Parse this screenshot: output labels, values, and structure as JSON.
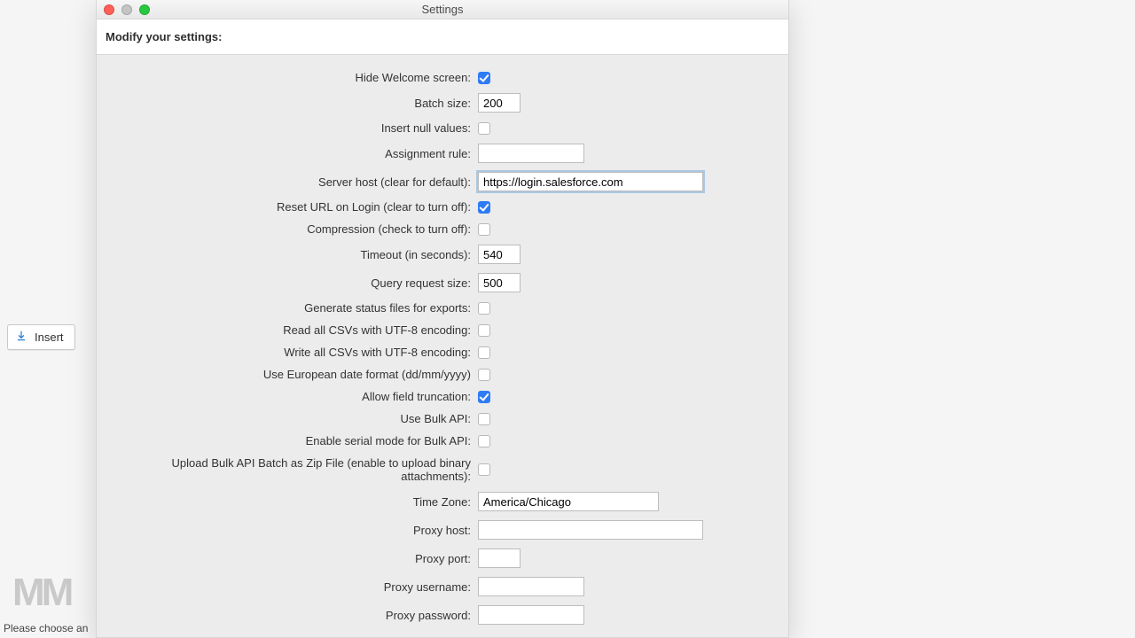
{
  "background": {
    "insert_button_label": "Insert",
    "status_text": "Please choose an",
    "watermark_text": "MM"
  },
  "window": {
    "title": "Settings",
    "header": "Modify your settings:"
  },
  "settings": {
    "hide_welcome": {
      "label": "Hide Welcome screen:",
      "checked": true
    },
    "batch_size": {
      "label": "Batch size:",
      "value": "200"
    },
    "insert_nulls": {
      "label": "Insert null values:",
      "checked": false
    },
    "assignment_rule": {
      "label": "Assignment rule:",
      "value": ""
    },
    "server_host": {
      "label": "Server host (clear for default):",
      "value": "https://login.salesforce.com"
    },
    "reset_url": {
      "label": "Reset URL on Login (clear to turn off):",
      "checked": true
    },
    "compression": {
      "label": "Compression (check to turn off):",
      "checked": false
    },
    "timeout": {
      "label": "Timeout (in seconds):",
      "value": "540"
    },
    "query_size": {
      "label": "Query request size:",
      "value": "500"
    },
    "gen_status": {
      "label": "Generate status files for exports:",
      "checked": false
    },
    "read_utf8": {
      "label": "Read all CSVs with UTF-8 encoding:",
      "checked": false
    },
    "write_utf8": {
      "label": "Write all CSVs with UTF-8 encoding:",
      "checked": false
    },
    "euro_date": {
      "label": "Use European date format (dd/mm/yyyy)",
      "checked": false
    },
    "truncation": {
      "label": "Allow field truncation:",
      "checked": true
    },
    "bulk_api": {
      "label": "Use Bulk API:",
      "checked": false
    },
    "serial_bulk": {
      "label": "Enable serial mode for Bulk API:",
      "checked": false
    },
    "zip_bulk": {
      "label": "Upload Bulk API Batch as Zip File (enable to upload binary attachments):",
      "checked": false
    },
    "timezone": {
      "label": "Time Zone:",
      "value": "America/Chicago"
    },
    "proxy_host": {
      "label": "Proxy host:",
      "value": ""
    },
    "proxy_port": {
      "label": "Proxy port:",
      "value": ""
    },
    "proxy_user": {
      "label": "Proxy username:",
      "value": ""
    },
    "proxy_pass": {
      "label": "Proxy password:",
      "value": ""
    }
  }
}
